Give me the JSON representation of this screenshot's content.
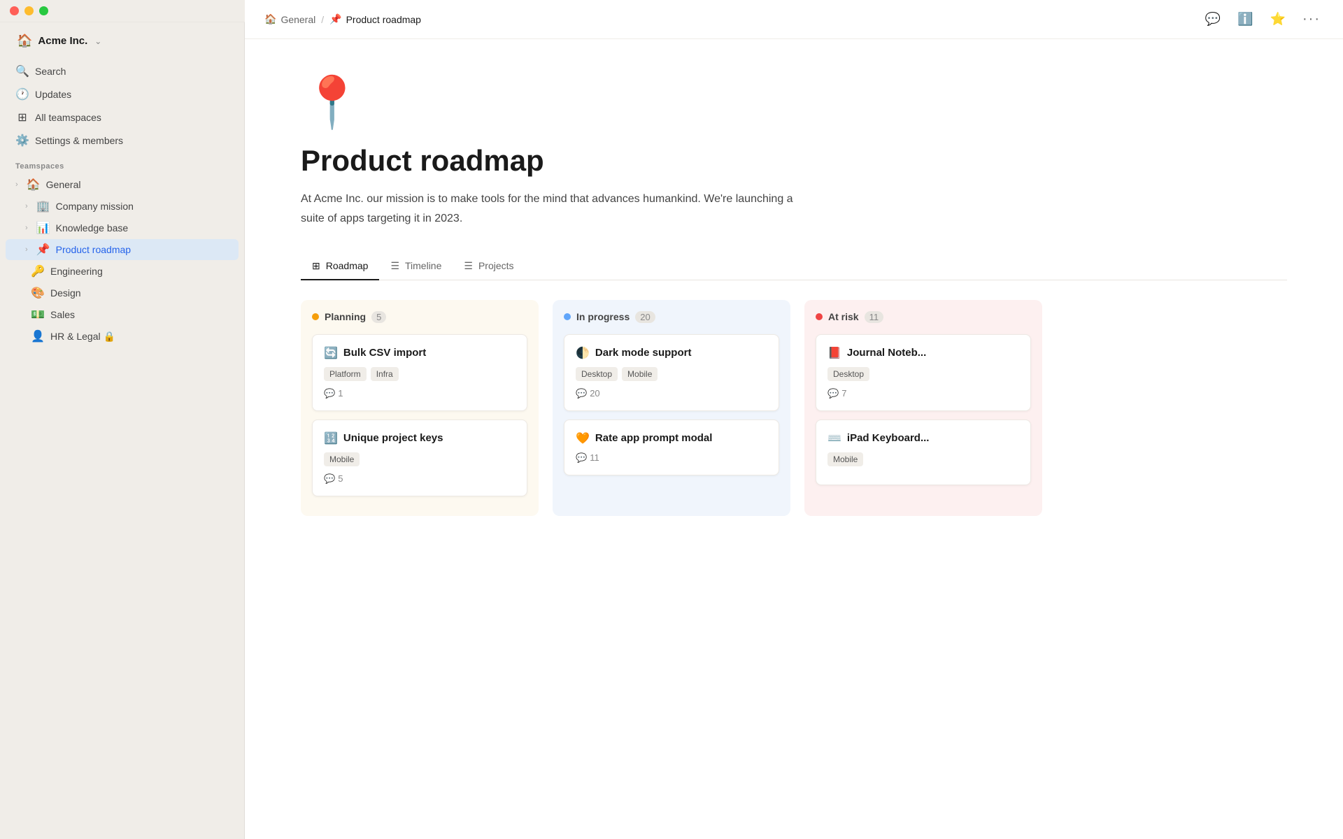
{
  "window": {
    "traffic_lights": [
      "red",
      "yellow",
      "green"
    ]
  },
  "sidebar": {
    "workspace": {
      "icon": "🏠",
      "name": "Acme Inc.",
      "chevron": "⌃"
    },
    "nav_items": [
      {
        "id": "search",
        "icon": "🔍",
        "label": "Search"
      },
      {
        "id": "updates",
        "icon": "🕐",
        "label": "Updates"
      },
      {
        "id": "all-teamspaces",
        "icon": "⊞",
        "label": "All teamspaces"
      },
      {
        "id": "settings",
        "icon": "⚙️",
        "label": "Settings & members"
      }
    ],
    "section_label": "Teamspaces",
    "teamspace_items": [
      {
        "id": "general",
        "icon": "🏠",
        "label": "General",
        "chevron": true,
        "active": false,
        "indent": false
      },
      {
        "id": "company-mission",
        "icon": "🏢",
        "label": "Company mission",
        "chevron": true,
        "active": false,
        "indent": true
      },
      {
        "id": "knowledge-base",
        "icon": "📊",
        "label": "Knowledge base",
        "chevron": true,
        "active": false,
        "indent": true
      },
      {
        "id": "product-roadmap",
        "icon": "📌",
        "label": "Product roadmap",
        "chevron": true,
        "active": true,
        "indent": true
      },
      {
        "id": "engineering",
        "icon": "🔑",
        "label": "Engineering",
        "chevron": false,
        "active": false,
        "indent": false
      },
      {
        "id": "design",
        "icon": "🎨",
        "label": "Design",
        "chevron": false,
        "active": false,
        "indent": false
      },
      {
        "id": "sales",
        "icon": "💵",
        "label": "Sales",
        "chevron": false,
        "active": false,
        "indent": false
      },
      {
        "id": "hr-legal",
        "icon": "👤",
        "label": "HR & Legal 🔒",
        "chevron": false,
        "active": false,
        "indent": false
      }
    ]
  },
  "topbar": {
    "breadcrumb": [
      {
        "icon": "🏠",
        "label": "General"
      },
      {
        "icon": "📌",
        "label": "Product roadmap"
      }
    ],
    "actions": [
      {
        "id": "comments",
        "icon": "💬"
      },
      {
        "id": "info",
        "icon": "ℹ️"
      },
      {
        "id": "star",
        "icon": "⭐"
      },
      {
        "id": "more",
        "icon": "•••"
      }
    ]
  },
  "page": {
    "emoji": "📍",
    "title": "Product roadmap",
    "description": "At Acme Inc. our mission is to make tools for the mind that advances humankind. We're launching a suite of apps targeting it in 2023.",
    "tabs": [
      {
        "id": "roadmap",
        "icon": "⊞",
        "label": "Roadmap",
        "active": true
      },
      {
        "id": "timeline",
        "icon": "☰",
        "label": "Timeline",
        "active": false
      },
      {
        "id": "projects",
        "icon": "☰",
        "label": "Projects",
        "active": false
      }
    ],
    "columns": [
      {
        "id": "planning",
        "title": "Planning",
        "count": "5",
        "color": "#f59e0b",
        "bg": "#fdf9f0",
        "cards": [
          {
            "id": "bulk-csv",
            "icon": "🔄",
            "title": "Bulk CSV import",
            "tags": [
              "Platform",
              "Infra"
            ],
            "comments": "1"
          },
          {
            "id": "unique-project-keys",
            "icon": "🔢",
            "title": "Unique project keys",
            "tags": [
              "Mobile"
            ],
            "comments": "5"
          }
        ]
      },
      {
        "id": "inprogress",
        "title": "In progress",
        "count": "20",
        "color": "#60a5fa",
        "bg": "#f0f5fc",
        "cards": [
          {
            "id": "dark-mode",
            "icon": "🌓",
            "title": "Dark mode support",
            "tags": [
              "Desktop",
              "Mobile"
            ],
            "comments": "20"
          },
          {
            "id": "rate-app",
            "icon": "🧡",
            "title": "Rate app prompt modal",
            "tags": [],
            "comments": "11"
          }
        ]
      },
      {
        "id": "atrisk",
        "title": "At risk",
        "count": "11",
        "color": "#ef4444",
        "bg": "#fdf0f0",
        "cards": [
          {
            "id": "journal-notebook",
            "icon": "📕",
            "title": "Journal Noteb...",
            "tags": [
              "Desktop"
            ],
            "comments": "7"
          },
          {
            "id": "ipad-keyboard",
            "icon": "⌨️",
            "title": "iPad Keyboard...",
            "tags": [
              "Mobile"
            ],
            "comments": ""
          }
        ]
      }
    ]
  }
}
